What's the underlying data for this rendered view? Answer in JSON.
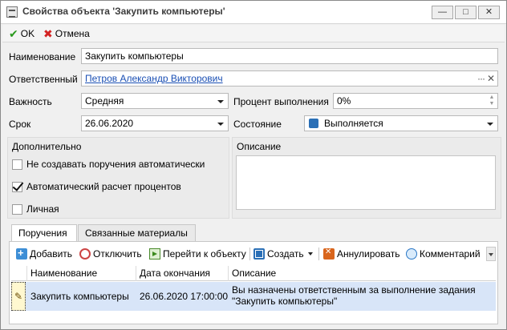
{
  "window": {
    "title": "Свойства объекта 'Закупить компьютеры'",
    "min_glyph": "—",
    "max_glyph": "□",
    "close_glyph": "✕"
  },
  "toolbar": {
    "ok_label": "OK",
    "cancel_label": "Отмена"
  },
  "form": {
    "name_label": "Наименование",
    "name_value": "Закупить компьютеры",
    "responsible_label": "Ответственный",
    "responsible_value": "Петров Александр Викторович",
    "importance_label": "Важность",
    "importance_value": "Средняя",
    "percent_label": "Процент выполнения",
    "percent_value": "0%",
    "deadline_label": "Срок",
    "deadline_value": "26.06.2020",
    "state_label": "Состояние",
    "state_value": "Выполняется"
  },
  "additional": {
    "title": "Дополнительно",
    "options": [
      {
        "label": "Не создавать поручения автоматически",
        "checked": false
      },
      {
        "label": "Автоматический расчет процентов",
        "checked": true
      },
      {
        "label": "Личная",
        "checked": false
      }
    ]
  },
  "description": {
    "title": "Описание",
    "value": ""
  },
  "tabs": [
    {
      "label": "Поручения",
      "active": true
    },
    {
      "label": "Связанные материалы",
      "active": false
    }
  ],
  "grid_toolbar": {
    "add": "Добавить",
    "detach": "Отключить",
    "goto": "Перейти к объекту",
    "create": "Создать",
    "annul": "Аннулировать",
    "comment": "Комментарий"
  },
  "grid": {
    "columns": [
      "Наименование",
      "Дата окончания",
      "Описание"
    ],
    "rows": [
      {
        "name": "Закупить компьютеры",
        "end_date": "26.06.2020 17:00:00",
        "description": "Вы назначены ответственным за выполнение задания \"Закупить компьютеры\""
      }
    ]
  },
  "icons": {
    "ok": "check-icon",
    "cancel": "cross-icon",
    "state": "puzzle-icon",
    "row": "task-pencil-icon"
  },
  "colors": {
    "link": "#1a4fb4",
    "ok_green": "#2a9a1e",
    "cancel_red": "#d32323",
    "selected_row": "#d8e5f8"
  }
}
